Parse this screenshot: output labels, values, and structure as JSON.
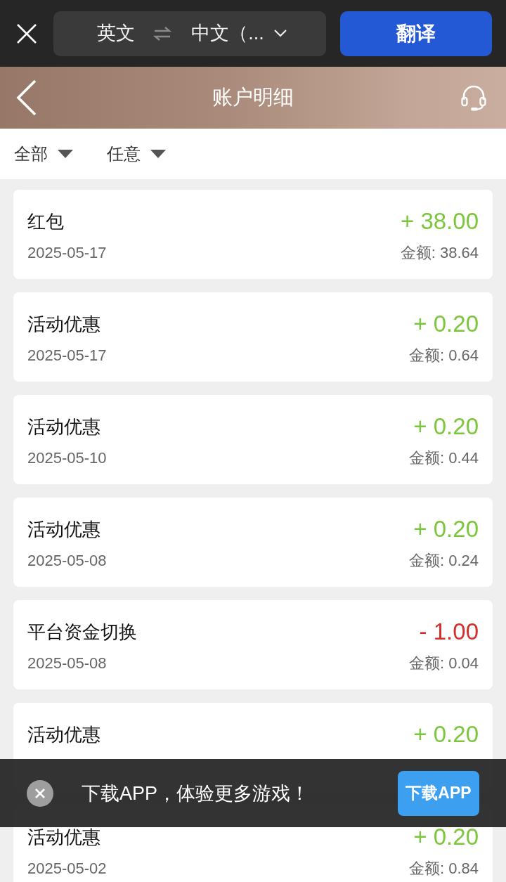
{
  "translate_bar": {
    "source_language": "英文",
    "target_language": "中文（...",
    "button": "翻译"
  },
  "header": {
    "title": "账户明细"
  },
  "filters": [
    {
      "label": "全部"
    },
    {
      "label": "任意"
    }
  ],
  "transactions": [
    {
      "title": "红包",
      "date": "2025-05-17",
      "amount": "+ 38.00",
      "kind": "credit",
      "balance": "金额: 38.64"
    },
    {
      "title": "活动优惠",
      "date": "2025-05-17",
      "amount": "+ 0.20",
      "kind": "credit",
      "balance": "金额: 0.64"
    },
    {
      "title": "活动优惠",
      "date": "2025-05-10",
      "amount": "+ 0.20",
      "kind": "credit",
      "balance": "金额: 0.44"
    },
    {
      "title": "活动优惠",
      "date": "2025-05-08",
      "amount": "+ 0.20",
      "kind": "credit",
      "balance": "金额: 0.24"
    },
    {
      "title": "平台资金切换",
      "date": "2025-05-08",
      "amount": "- 1.00",
      "kind": "debit",
      "balance": "金额: 0.04"
    },
    {
      "title": "活动优惠",
      "amount": "+ 0.20",
      "kind": "credit"
    },
    {
      "title": "活动优惠",
      "date": "2025-05-02",
      "amount": "+ 0.20",
      "kind": "credit",
      "balance": "金额: 0.84"
    }
  ],
  "download_banner": {
    "message": "下载APP，体验更多游戏！",
    "button": "下载APP"
  }
}
